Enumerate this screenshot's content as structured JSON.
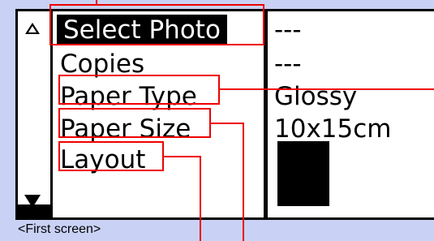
{
  "menu": {
    "items": [
      {
        "label": "Select Photo",
        "value": "---"
      },
      {
        "label": "Copies",
        "value": "---"
      },
      {
        "label": "Paper Type",
        "value": "Glossy"
      },
      {
        "label": "Paper Size",
        "value": "10x15cm"
      },
      {
        "label": "Layout",
        "value": ""
      }
    ],
    "selected_index": 0
  },
  "caption": "<First screen>",
  "colors": {
    "background": "#c9d1f5",
    "callout": "#e00000",
    "highlight": "#000000"
  },
  "icons": {
    "scroll_up": "up-arrow-icon",
    "scroll_down": "down-arrow-icon"
  }
}
